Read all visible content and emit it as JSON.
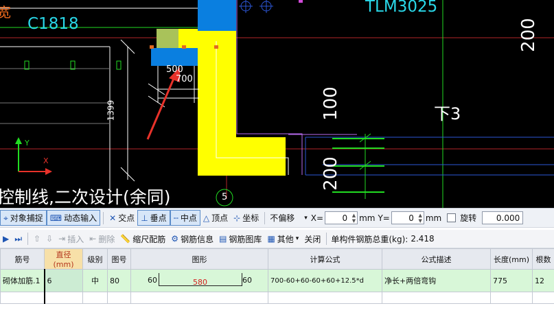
{
  "canvas": {
    "labels": {
      "c1818": "C1818",
      "tlm3025": "TLM3025",
      "dim_200_top": "200",
      "dim_100": "100",
      "dim_200_bottom": "200",
      "xia3": "下3",
      "dim_500": "500",
      "dim_700": "700",
      "dim_1399": "1399",
      "axis_y": "Y",
      "axis_x": "X",
      "grid_5": "5",
      "partial_top_left": "宽",
      "annotation": "控制线,二次设计(余同)"
    },
    "colors": {
      "background": "#000000",
      "yellow": "#ffff00",
      "blue": "#0a7fe0",
      "cyan_text": "#29d7e8",
      "green": "#22dd22",
      "red_arrow": "#e8322a"
    }
  },
  "snap_toolbar": {
    "object_snap": "对象捕捉",
    "dynamic_input": "动态输入",
    "intersection": "交点",
    "perpendicular": "垂点",
    "midpoint": "中点",
    "vertex": "顶点",
    "coordinate": "坐标",
    "offset_mode": "不偏移",
    "x_label": "X=",
    "x_value": "0",
    "x_unit": "mm",
    "y_label": "Y=",
    "y_value": "0",
    "y_unit": "mm",
    "rotate_label": "旋转",
    "rotate_value": "0.000"
  },
  "rebar_toolbar": {
    "insert": "插入",
    "delete": "删除",
    "scale_rebar": "缩尺配筋",
    "rebar_info": "钢筋信息",
    "rebar_library": "钢筋图库",
    "other": "其他",
    "close": "关闭",
    "total_weight_label": "单构件钢筋总重(kg):",
    "total_weight_value": "2.418"
  },
  "table": {
    "headers": [
      "筋号",
      "直径(mm)",
      "级别",
      "图号",
      "图形",
      "计算公式",
      "公式描述",
      "长度(mm)",
      "根数"
    ],
    "rows": [
      {
        "bar_no": "砌体加筋.1",
        "diameter": "6",
        "grade": "中",
        "figure_no": "80",
        "shape_left": "60",
        "shape_mid": "580",
        "shape_right": "60",
        "formula": "700-60+60-60+60+12.5*d",
        "description": "净长+两倍弯钩",
        "length": "775",
        "count": "12"
      }
    ]
  }
}
